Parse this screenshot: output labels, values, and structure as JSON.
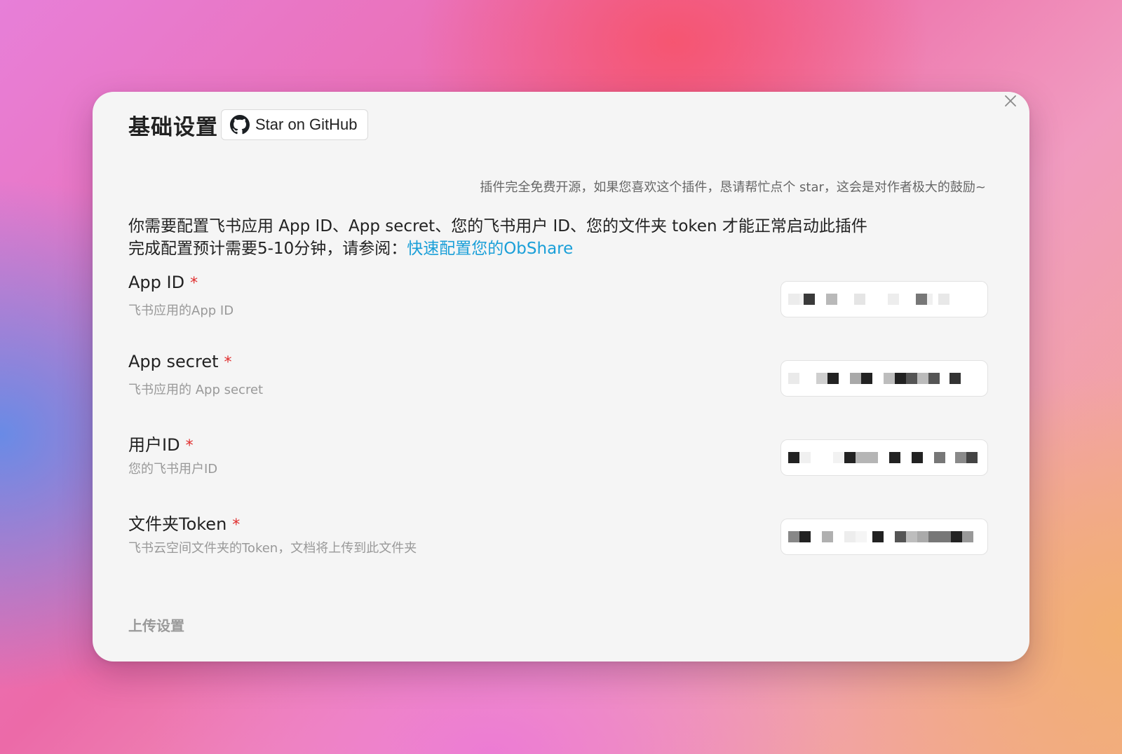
{
  "modal": {
    "title": "基础设置",
    "github_button_label": "Star on GitHub",
    "close_icon": "close-icon",
    "github_icon": "github-icon"
  },
  "notice": "插件完全免费开源，如果您喜欢这个插件，恳请帮忙点个 star，这会是对作者极大的鼓励~",
  "intro": {
    "line1": "你需要配置飞书应用 App ID、App secret、您的飞书用户 ID、您的文件夹 token 才能正常启动此插件",
    "line2_prefix": "完成配置预计需要5-10分钟，请参阅：",
    "line2_link": "快速配置您的ObShare"
  },
  "fields": [
    {
      "label": "App ID",
      "required_mark": "*",
      "description": "飞书应用的App ID"
    },
    {
      "label": "App secret",
      "required_mark": "*",
      "description": "飞书应用的 App secret"
    },
    {
      "label": "用户ID",
      "required_mark": "*",
      "description": "您的飞书用户ID"
    },
    {
      "label": "文件夹Token",
      "required_mark": "*",
      "description": "飞书云空间文件夹的Token，文档将上传到此文件夹"
    }
  ],
  "upload_section_title": "上传设置",
  "colors": {
    "link": "#1a9fd8",
    "required": "#e02d2d",
    "modal_bg": "#f5f5f5"
  }
}
